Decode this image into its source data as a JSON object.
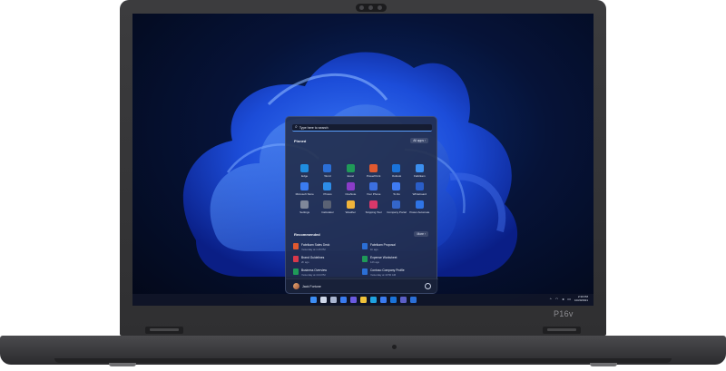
{
  "device": {
    "model_label": "P16v"
  },
  "start_menu": {
    "search_placeholder": "Type here to search",
    "pinned_title": "Pinned",
    "all_apps_label": "All apps  ›",
    "pinned_apps": [
      {
        "label": "Edge",
        "color": "#1f8de0"
      },
      {
        "label": "Word",
        "color": "#2b6fd6"
      },
      {
        "label": "Excel",
        "color": "#1f9a58"
      },
      {
        "label": "PowerPoint",
        "color": "#e0592f"
      },
      {
        "label": "Outlook",
        "color": "#1a73d9"
      },
      {
        "label": "Fabrikam",
        "color": "#3b8ff0"
      },
      {
        "label": "Microsoft Store",
        "color": "#3a7bf0"
      },
      {
        "label": "Photos",
        "color": "#2d8de8"
      },
      {
        "label": "OneNote",
        "color": "#8b3cc8"
      },
      {
        "label": "Your Phone",
        "color": "#3c6fe0"
      },
      {
        "label": "To Do",
        "color": "#3f7bf2"
      },
      {
        "label": "Whiteboard",
        "color": "#2a5ec8"
      },
      {
        "label": "Settings",
        "color": "#7f8799"
      },
      {
        "label": "Calculator",
        "color": "#5a6274"
      },
      {
        "label": "Weather",
        "color": "#f0b43a"
      },
      {
        "label": "Snipping Tool",
        "color": "#d9386a"
      },
      {
        "label": "Company Portal",
        "color": "#3466c9"
      },
      {
        "label": "Power Automate",
        "color": "#2f74e6"
      }
    ],
    "recommended_title": "Recommended",
    "more_label": "More  ›",
    "recommended": [
      {
        "name": "Fabrikam Sales Deck",
        "time": "Yesterday at 1:15 PM",
        "color": "#e0592f"
      },
      {
        "name": "Fabrikam Proposal",
        "time": "1h ago",
        "color": "#2b6fd6"
      },
      {
        "name": "Brand Guidelines",
        "time": "2h ago",
        "color": "#d9384a"
      },
      {
        "name": "Expense Worksheet",
        "time": "12h ago",
        "color": "#1f9a58"
      },
      {
        "name": "Business Overview",
        "time": "Yesterday at 4:24 PM",
        "color": "#1f9a58"
      },
      {
        "name": "Contoso Company Profile",
        "time": "Yesterday at 10:50 AM",
        "color": "#2b6fd6"
      }
    ],
    "user_name": "Jack Fortune"
  },
  "taskbar": {
    "icons": [
      {
        "name": "windows-start",
        "color": "#3d8ef5"
      },
      {
        "name": "search",
        "color": "#cfd8ea"
      },
      {
        "name": "task-view",
        "color": "#aab6d0"
      },
      {
        "name": "widgets",
        "color": "#3a7bf0"
      },
      {
        "name": "chat",
        "color": "#6a5ae0"
      },
      {
        "name": "file-explorer",
        "color": "#f0c23a"
      },
      {
        "name": "edge",
        "color": "#1fa2e0"
      },
      {
        "name": "store",
        "color": "#3a7bf0"
      },
      {
        "name": "outlook",
        "color": "#1a73d9"
      },
      {
        "name": "teams",
        "color": "#5b5fc7"
      },
      {
        "name": "word",
        "color": "#2b6fd6"
      }
    ],
    "clock_time": "2:30 PM",
    "clock_date": "10/20/2021"
  }
}
